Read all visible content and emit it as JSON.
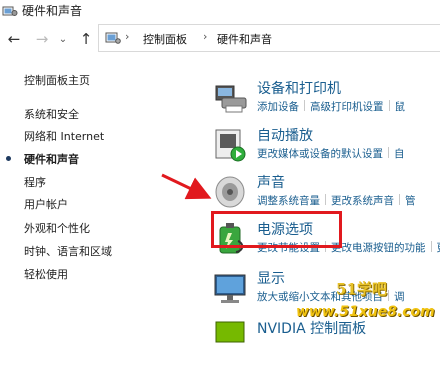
{
  "window": {
    "title": "硬件和声音"
  },
  "nav": {
    "back": "←",
    "forward": "→",
    "history": "⌄",
    "up": "↑"
  },
  "address": {
    "segments": [
      "控制面板",
      "硬件和声音"
    ],
    "sep": "›"
  },
  "sidebar": {
    "items": [
      {
        "label": "控制面板主页",
        "current": false
      },
      {
        "label": "系统和安全",
        "current": false
      },
      {
        "label": "网络和 Internet",
        "current": false
      },
      {
        "label": "硬件和声音",
        "current": true
      },
      {
        "label": "程序",
        "current": false
      },
      {
        "label": "用户帐户",
        "current": false
      },
      {
        "label": "外观和个性化",
        "current": false
      },
      {
        "label": "时钟、语言和区域",
        "current": false
      },
      {
        "label": "轻松使用",
        "current": false
      }
    ]
  },
  "categories": [
    {
      "title": "设备和打印机",
      "icon": "printer-icon",
      "links": [
        "添加设备",
        "高级打印机设置",
        "鼠"
      ]
    },
    {
      "title": "自动播放",
      "icon": "autoplay-icon",
      "links": [
        "更改媒体或设备的默认设置",
        "自"
      ]
    },
    {
      "title": "声音",
      "icon": "speaker-icon",
      "links": [
        "调整系统音量",
        "更改系统声音",
        "管"
      ]
    },
    {
      "title": "电源选项",
      "icon": "battery-icon",
      "links": [
        "更改节能设置",
        "更改电源按钮的功能",
        "更"
      ]
    },
    {
      "title": "显示",
      "icon": "monitor-icon",
      "links": [
        "放大或缩小文本和其他项目",
        "调"
      ]
    },
    {
      "title": "NVIDIA 控制面板",
      "icon": "nvidia-icon",
      "links": []
    }
  ],
  "watermark": {
    "line1": "51学吧",
    "line2": "www.51xue8.com"
  },
  "colors": {
    "link": "#1a5e8f",
    "highlight": "#e1191e",
    "arrow": "#e1191e"
  }
}
